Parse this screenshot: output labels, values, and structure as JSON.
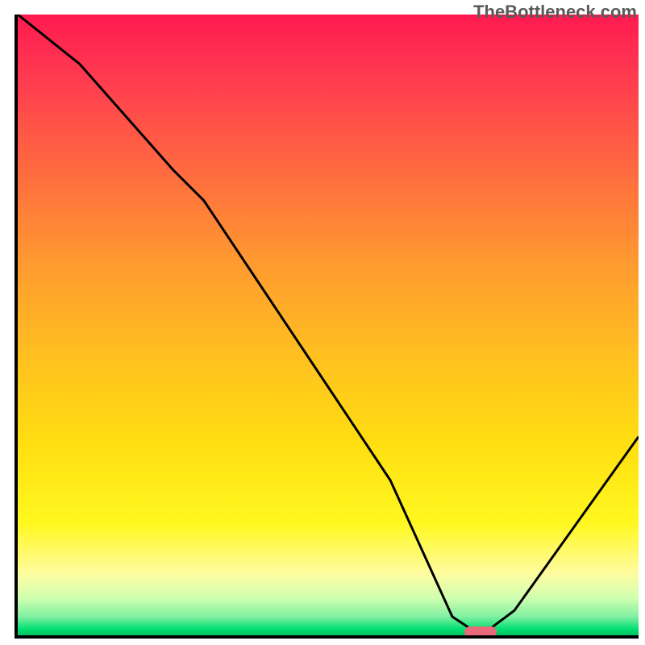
{
  "watermark": "TheBottleneck.com",
  "chart_data": {
    "type": "line",
    "title": "",
    "xlabel": "",
    "ylabel": "",
    "xlim": [
      0,
      100
    ],
    "ylim": [
      0,
      100
    ],
    "series": [
      {
        "name": "bottleneck-curve",
        "x": [
          0,
          10,
          25,
          30,
          40,
          50,
          60,
          65,
          70,
          73,
          76,
          80,
          100
        ],
        "y": [
          100,
          92,
          75,
          70,
          55,
          40,
          25,
          14,
          3,
          1,
          1,
          4,
          32
        ]
      }
    ],
    "optimum_marker": {
      "x": 74.5,
      "y": 0.5
    },
    "gradient_stops": [
      {
        "pos": 0,
        "color": "#ff1a50"
      },
      {
        "pos": 10,
        "color": "#ff3a50"
      },
      {
        "pos": 25,
        "color": "#ff6a40"
      },
      {
        "pos": 40,
        "color": "#ff9a30"
      },
      {
        "pos": 55,
        "color": "#ffc020"
      },
      {
        "pos": 70,
        "color": "#ffe010"
      },
      {
        "pos": 82,
        "color": "#fff820"
      },
      {
        "pos": 90,
        "color": "#fffca0"
      },
      {
        "pos": 94,
        "color": "#d0ffb0"
      },
      {
        "pos": 97,
        "color": "#80f0a0"
      },
      {
        "pos": 99,
        "color": "#00e070"
      },
      {
        "pos": 100,
        "color": "#00c060"
      }
    ]
  }
}
